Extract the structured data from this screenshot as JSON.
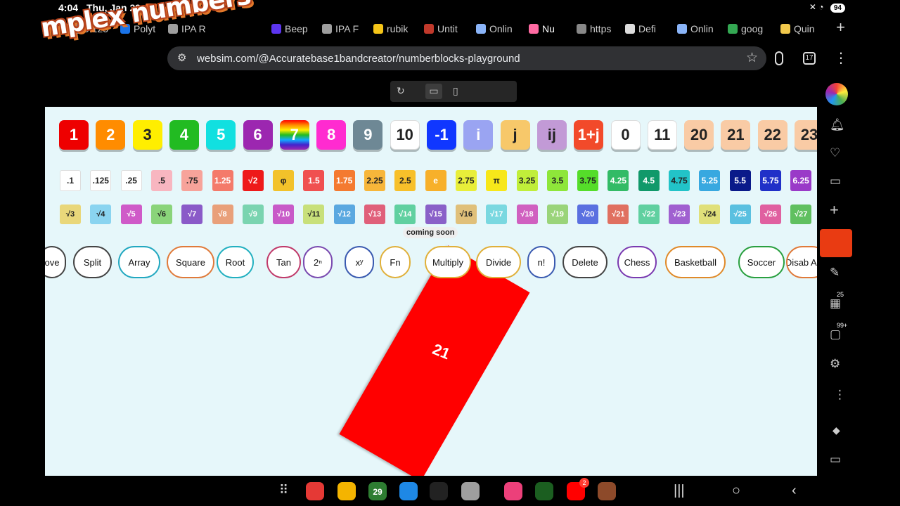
{
  "status": {
    "time": "4:04",
    "date": "Thu, Jan 29",
    "battery": "94"
  },
  "tabs": [
    {
      "label": "0.125",
      "color": "#4285f4"
    },
    {
      "label": "Polyt",
      "color": "#1a73e8"
    },
    {
      "label": "IPA R",
      "color": "#9e9e9e"
    },
    {
      "label": "Beep",
      "color": "#5c35f0"
    },
    {
      "label": "IPA F",
      "color": "#9e9e9e"
    },
    {
      "label": "rubik",
      "color": "#f5c518"
    },
    {
      "label": "Untit",
      "color": "#c0392b"
    },
    {
      "label": "Onlin",
      "color": "#8ab4f8"
    },
    {
      "label": "Nu",
      "color": "#ff6aa2"
    },
    {
      "label": "https",
      "color": "#888888"
    },
    {
      "label": "Defi",
      "color": "#dddddd"
    },
    {
      "label": "Onlin",
      "color": "#8ab4f8"
    },
    {
      "label": "goog",
      "color": "#34a853"
    },
    {
      "label": "Quin",
      "color": "#f2c94c"
    }
  ],
  "address": {
    "url": "websim.com/@Accuratebase1bandcreator/numberblocks-playground",
    "tab_count": "17"
  },
  "sticker": {
    "text": "mplex numbers"
  },
  "playground": {
    "big_row": [
      {
        "label": "1",
        "color": "#ee0000"
      },
      {
        "label": "2",
        "color": "#ff8c00"
      },
      {
        "label": "3",
        "color": "#ffee00",
        "dark": true
      },
      {
        "label": "4",
        "color": "#22bb22"
      },
      {
        "label": "5",
        "color": "#11e0e0"
      },
      {
        "label": "6",
        "color": "#9c27b0"
      },
      {
        "label": "7",
        "color": "rainbow"
      },
      {
        "label": "8",
        "color": "#ff2bd0"
      },
      {
        "label": "9",
        "color": "#6e8895"
      },
      {
        "label": "10",
        "color": "#ffffff",
        "dark": true
      },
      {
        "label": "-1",
        "color": "#1037ff"
      },
      {
        "label": "i",
        "color": "#9aa4f2"
      },
      {
        "label": "j",
        "color": "#f7c86a",
        "dark": true
      },
      {
        "label": "ij",
        "color": "#c29ad6",
        "dark": true
      },
      {
        "label": "1+j",
        "color": "#f24a2a"
      },
      {
        "label": "0",
        "color": "#ffffff",
        "dark": true
      },
      {
        "label": "11",
        "color": "#ffffff",
        "dark": true
      },
      {
        "label": "20",
        "color": "#f9cba5",
        "dark": true
      },
      {
        "label": "21",
        "color": "#f9cba5",
        "dark": true
      },
      {
        "label": "22",
        "color": "#f9cba5",
        "dark": true
      },
      {
        "label": "23",
        "color": "#f9cba5",
        "dark": true
      }
    ],
    "decimal_row": [
      {
        "label": ".1",
        "color": "#ffffff",
        "dark": true
      },
      {
        "label": ".125",
        "color": "#ffffff",
        "dark": true
      },
      {
        "label": ".25",
        "color": "#ffffff",
        "dark": true
      },
      {
        "label": ".5",
        "color": "#f8b6c0",
        "dark": true
      },
      {
        "label": ".75",
        "color": "#f7a39a",
        "dark": true
      },
      {
        "label": "1.25",
        "color": "#f47a6a"
      },
      {
        "label": "√2",
        "color": "#ee1a1a"
      },
      {
        "label": "φ",
        "color": "#f2c22a",
        "dark": true
      },
      {
        "label": "1.5",
        "color": "#f05050"
      },
      {
        "label": "1.75",
        "color": "#f47a30"
      },
      {
        "label": "2.25",
        "color": "#f7b63a",
        "dark": true
      },
      {
        "label": "2.5",
        "color": "#f7c02a",
        "dark": true
      },
      {
        "label": "e",
        "color": "#f7b02a"
      },
      {
        "label": "2.75",
        "color": "#e8ee3a",
        "dark": true
      },
      {
        "label": "π",
        "color": "#f7e71a",
        "dark": true
      },
      {
        "label": "3.25",
        "color": "#c0ee3a",
        "dark": true
      },
      {
        "label": "3.5",
        "color": "#8ee63a",
        "dark": true
      },
      {
        "label": "3.75",
        "color": "#55dd2a",
        "dark": true
      },
      {
        "label": "4.25",
        "color": "#33bb66"
      },
      {
        "label": "4.5",
        "color": "#11996a"
      },
      {
        "label": "4.75",
        "color": "#22c3c8",
        "dark": true
      },
      {
        "label": "5.25",
        "color": "#38a8e0"
      },
      {
        "label": "5.5",
        "color": "#0a1a8a"
      },
      {
        "label": "5.75",
        "color": "#2030c8"
      },
      {
        "label": "6.25",
        "color": "#9a3ac8"
      }
    ],
    "root_row": [
      {
        "label": "√3",
        "color": "#e9d77a",
        "dark": true
      },
      {
        "label": "√4",
        "color": "#8ad4f0",
        "dark": true
      },
      {
        "label": "√5",
        "color": "#cf5ac8"
      },
      {
        "label": "√6",
        "color": "#8ad47a",
        "dark": true
      },
      {
        "label": "√7",
        "color": "#8a5ac8"
      },
      {
        "label": "√8",
        "color": "#e9a07a"
      },
      {
        "label": "√9",
        "color": "#7ad4b0"
      },
      {
        "label": "√10",
        "color": "#c85ac8"
      },
      {
        "label": "√11",
        "color": "#c8e07a",
        "dark": true
      },
      {
        "label": "√12",
        "color": "#5aa8e0"
      },
      {
        "label": "√13",
        "color": "#e0607a"
      },
      {
        "label": "√14",
        "color": "#60d0a0"
      },
      {
        "label": "√15",
        "color": "#8a60c8"
      },
      {
        "label": "√16",
        "color": "#e0c07a",
        "dark": true
      },
      {
        "label": "√17",
        "color": "#7ad8e0"
      },
      {
        "label": "√18",
        "color": "#d060c0"
      },
      {
        "label": "√19",
        "color": "#9ad47a"
      },
      {
        "label": "√20",
        "color": "#5a70e0"
      },
      {
        "label": "√21",
        "color": "#e07060"
      },
      {
        "label": "√22",
        "color": "#60d0a0"
      },
      {
        "label": "√23",
        "color": "#a060d0"
      },
      {
        "label": "√24",
        "color": "#e0e07a",
        "dark": true
      },
      {
        "label": "√25",
        "color": "#5ac0e0"
      },
      {
        "label": "√26",
        "color": "#e060a0"
      },
      {
        "label": "√27",
        "color": "#60c060"
      }
    ],
    "coming_soon": "coming soon",
    "buttons": [
      {
        "label": "ove",
        "border": "#444444"
      },
      {
        "label": "Split",
        "border": "#444444"
      },
      {
        "label": "Array",
        "border": "#22a8c0"
      },
      {
        "label": "Square",
        "border": "#e07a3a"
      },
      {
        "label": "Root",
        "border": "#22b0c0"
      },
      {
        "label": "Tan",
        "border": "#c03a6a"
      },
      {
        "label": "2ⁿ",
        "border": "#7a4ab0"
      },
      {
        "label": "xʸ",
        "border": "#3a5ab0"
      },
      {
        "label": "Fn",
        "border": "#e0b03a"
      },
      {
        "label": "Multiply",
        "border": "#e0b03a"
      },
      {
        "label": "Divide",
        "border": "#e0b03a"
      },
      {
        "label": "n!",
        "border": "#3a5ab0"
      },
      {
        "label": "Delete",
        "border": "#444444"
      },
      {
        "label": "Chess",
        "border": "#7a3ab0"
      },
      {
        "label": "Basketball",
        "border": "#e08a2a"
      },
      {
        "label": "Soccer",
        "border": "#2aa040"
      },
      {
        "label": "Disab Addi",
        "border": "#e07a3a"
      }
    ],
    "block": {
      "label": "21",
      "color": "#ff0000"
    }
  },
  "side_panel": {
    "badge_apps": "25",
    "badge_msgs": "99+"
  },
  "taskbar": {
    "calendar_day": "29",
    "youtube_badge": "2",
    "apps": [
      {
        "name": "app-red",
        "color": "#e53935"
      },
      {
        "name": "app-files",
        "color": "#f4b400"
      },
      {
        "name": "app-calendar",
        "color": "#2e7d32"
      },
      {
        "name": "app-messages",
        "color": "#1e88e5"
      },
      {
        "name": "app-dots",
        "color": "#222222"
      },
      {
        "name": "app-camera",
        "color": "#9e9e9e"
      },
      {
        "name": "app-flower",
        "color": "#ec407a"
      },
      {
        "name": "app-green",
        "color": "#1b5e20"
      },
      {
        "name": "app-youtube",
        "color": "#ff0000"
      },
      {
        "name": "app-avatar",
        "color": "#8d4a2a"
      }
    ]
  }
}
